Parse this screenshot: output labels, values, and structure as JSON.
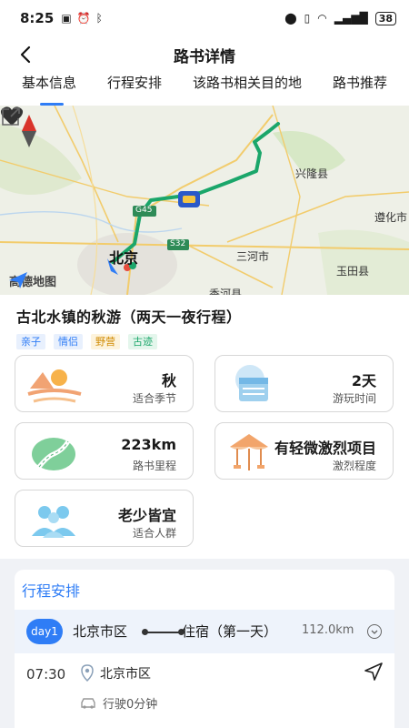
{
  "status_bar": {
    "time": "8:25",
    "battery": "38",
    "icons": [
      "nfc-icon",
      "alarm-icon",
      "bluetooth-icon",
      "location-icon",
      "vibrate-icon",
      "wifi-icon",
      "signal-icon",
      "battery-icon"
    ]
  },
  "header": {
    "title": "路书详情"
  },
  "tabs": [
    {
      "label": "基本信息",
      "active": true
    },
    {
      "label": "行程安排",
      "active": false
    },
    {
      "label": "该路书相关目的地",
      "active": false
    },
    {
      "label": "路书推荐",
      "active": false
    }
  ],
  "map": {
    "road_badges": [
      "G45",
      "S32"
    ],
    "place_labels": [
      "兴隆县",
      "遵化市",
      "北京",
      "三河市",
      "玉田县",
      "香河县"
    ],
    "provider": "高德地图",
    "route_color": "#1aa66a"
  },
  "route": {
    "title": "古北水镇的秋游（两天一夜行程）",
    "tags": [
      {
        "label": "亲子",
        "color": "#2f7df6",
        "bg": "#e8f0fd"
      },
      {
        "label": "情侣",
        "color": "#2f7df6",
        "bg": "#e8f0fd"
      },
      {
        "label": "野营",
        "color": "#d08a00",
        "bg": "#fdf3dc"
      },
      {
        "label": "古迹",
        "color": "#1aa66a",
        "bg": "#e4f6ec"
      }
    ]
  },
  "cards": {
    "season": {
      "value": "秋",
      "label": "适合季节",
      "icon": "autumn-icon"
    },
    "duration": {
      "value": "2天",
      "label": "游玩时间",
      "icon": "calendar-icon"
    },
    "distance": {
      "value": "223km",
      "label": "路书里程",
      "icon": "road-icon"
    },
    "intensity": {
      "value": "有轻微激烈项目",
      "label": "激烈程度",
      "icon": "carousel-icon"
    },
    "audience": {
      "value": "老少皆宜",
      "label": "适合人群",
      "icon": "people-icon"
    }
  },
  "schedule": {
    "title": "行程安排",
    "day": {
      "badge": "day1",
      "from": "北京市区",
      "to": "住宿（第一天）",
      "distance": "112.0km"
    },
    "stop": {
      "time": "07:30",
      "name": "北京市区",
      "drive": "行驶0分钟"
    }
  }
}
